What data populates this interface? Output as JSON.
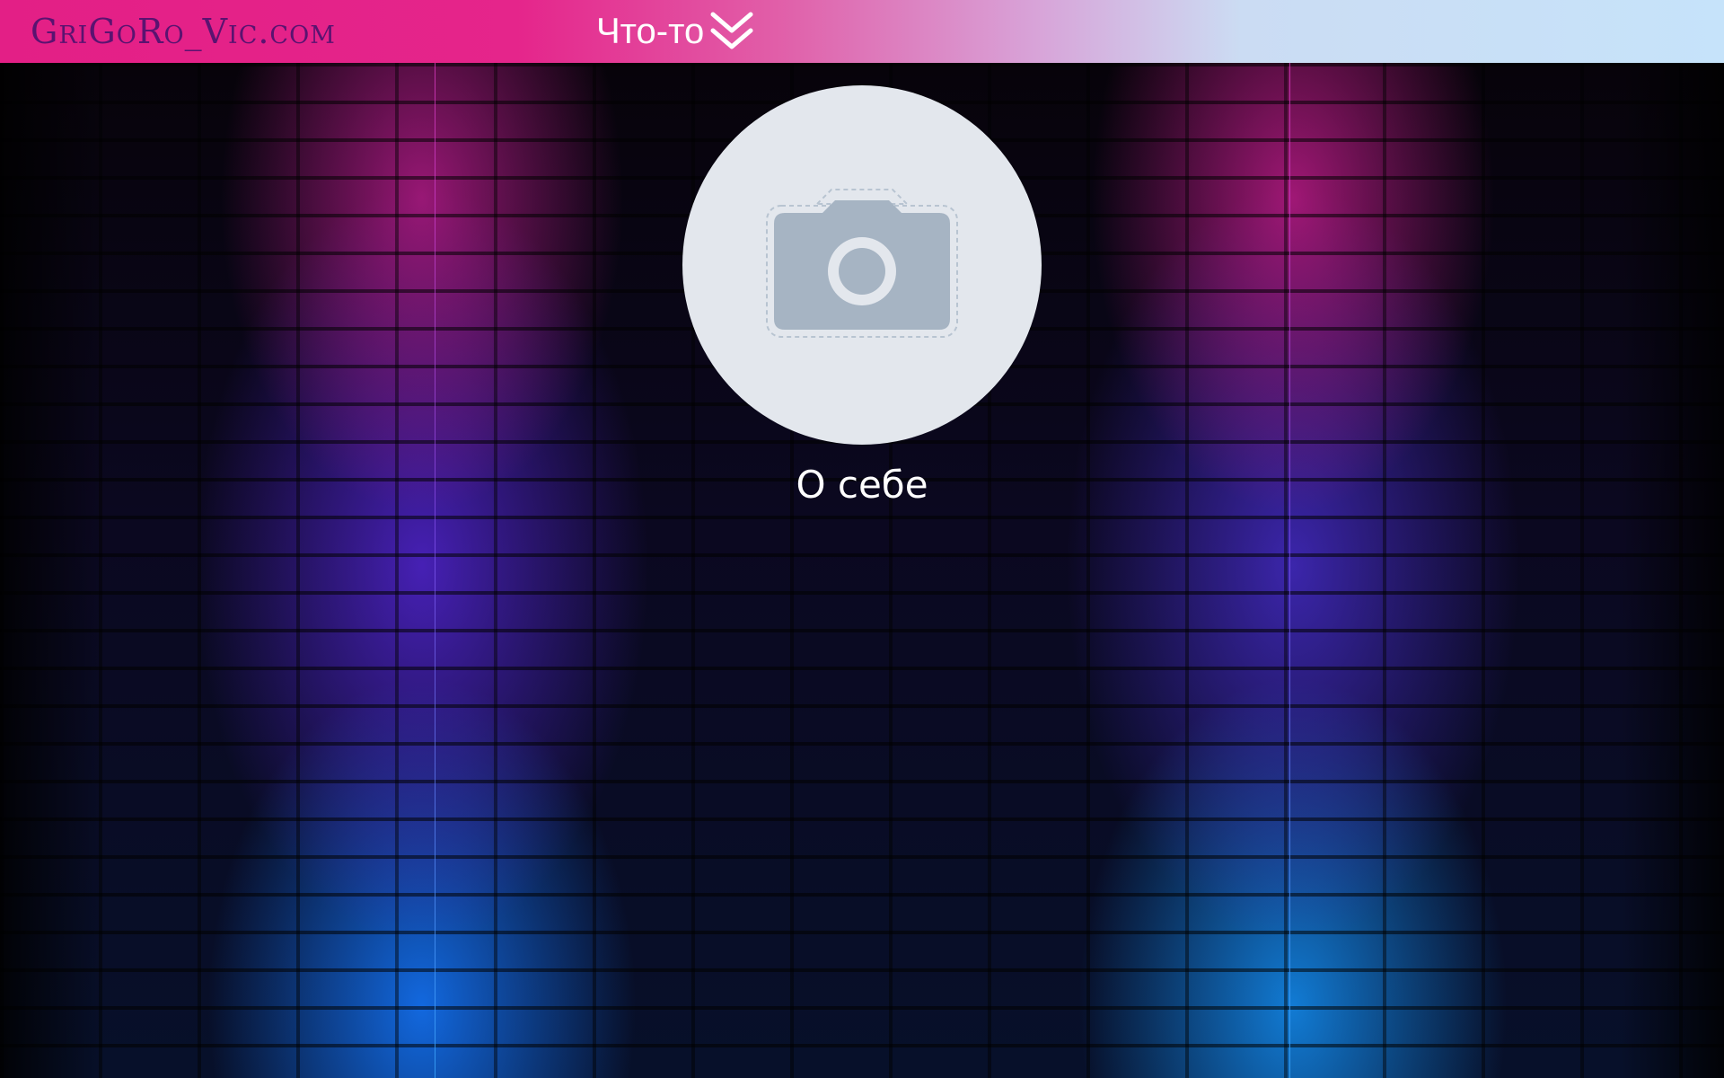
{
  "header": {
    "logo": "GriGoRo_Vic.com",
    "menu_label": "Что-то"
  },
  "profile": {
    "caption": "О себе"
  },
  "icons": {
    "menu": "double-chevron-down-icon",
    "avatar": "camera-icon"
  },
  "colors": {
    "header_pink": "#e31f86",
    "header_light_blue": "#c6e3fa",
    "logo_text": "#5a1370",
    "avatar_bg": "#e3e7ed",
    "camera_fill": "#a6b4c3"
  }
}
